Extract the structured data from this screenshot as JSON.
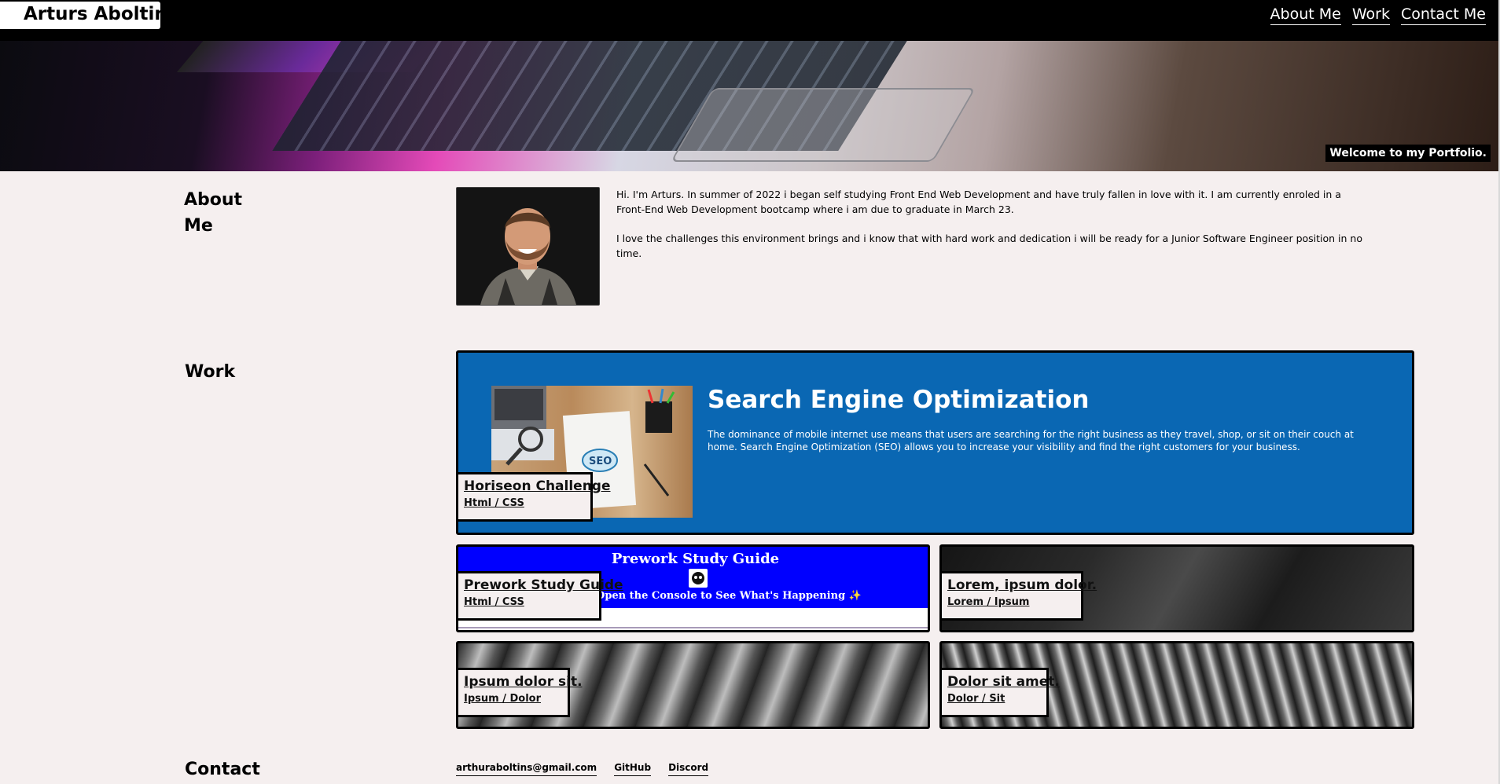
{
  "header": {
    "brand": "Arturs Aboltins",
    "nav": [
      "About Me",
      "Work",
      "Contact Me"
    ]
  },
  "hero": {
    "caption": "Welcome to my Portfolio."
  },
  "about": {
    "title_line1": "About",
    "title_line2": "Me",
    "paragraphs": [
      "Hi. I'm Arturs. In summer of 2022 i began self studying Front End Web Development and have truly fallen in love with it. I am currently enroled in a Front-End Web Development bootcamp where i am due to graduate in March 23.",
      "I love the challenges this environment brings and i know that with hard work and dedication i will be ready for a Junior Software Engineer position in no time."
    ]
  },
  "work": {
    "title": "Work",
    "featured": {
      "heading": "Search Engine Optimization",
      "description": "The dominance of mobile internet use means that users are searching for the right business as they travel, shop, or sit on their couch at home. Search Engine Optimization (SEO) allows you to increase your visibility and find the right customers for your business.",
      "image_text": "SEO",
      "label": "Horiseon Challenge",
      "sub": "Html / CSS"
    },
    "projects": [
      {
        "label": "Prework Study Guide",
        "sub": "Html / CSS",
        "preview_title": "Prework Study Guide",
        "preview_text": "Open the Console to See What's Happening ✨"
      },
      {
        "label": "Lorem, ipsum dolor.",
        "sub": "Lorem / Ipsum"
      },
      {
        "label": "Ipsum dolor sit.",
        "sub": "Ipsum / Dolor"
      },
      {
        "label": "Dolor sit amet.",
        "sub": "Dolor / Sit"
      }
    ],
    "colors": {
      "featured_bg": "#0a67b3",
      "prework_bg": "#0000ff"
    }
  },
  "contact": {
    "title": "Contact",
    "links": [
      "arthuraboltins@gmail.com",
      "GitHub",
      "Discord"
    ]
  }
}
